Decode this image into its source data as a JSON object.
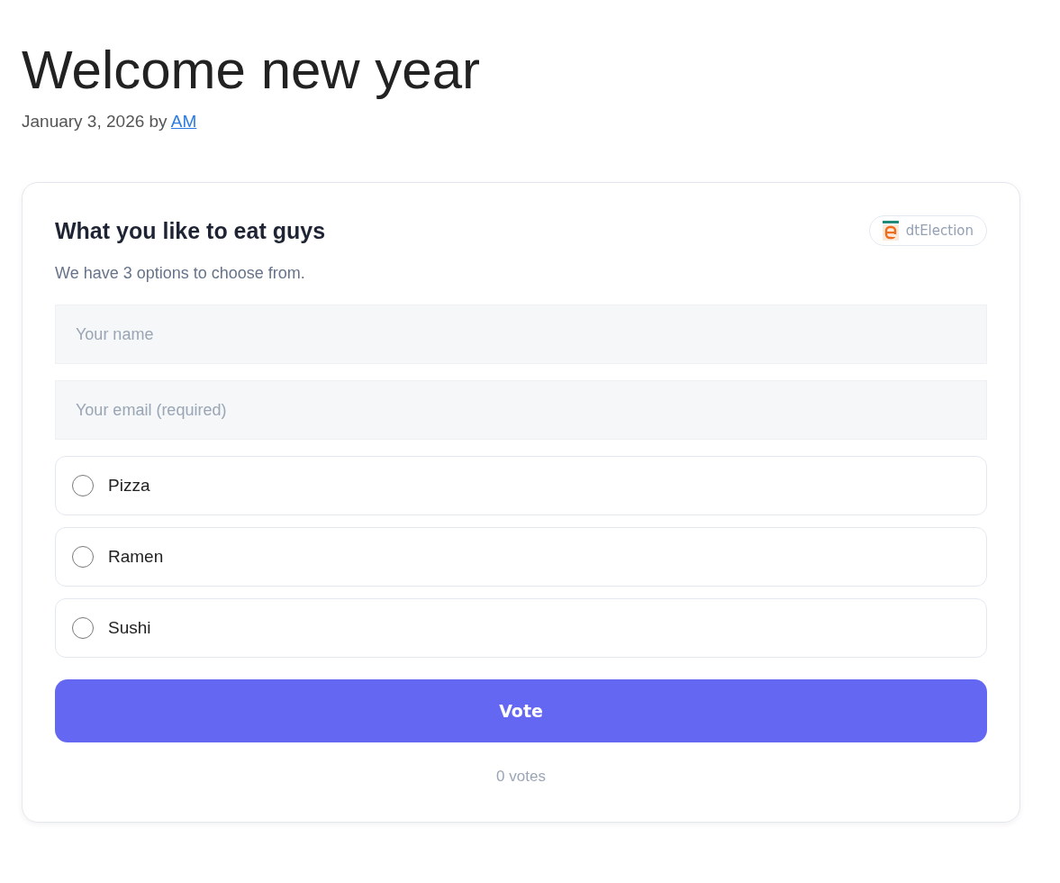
{
  "post": {
    "title": "Welcome new year",
    "byline": "January 3, 2026 by",
    "author": "AM"
  },
  "poll": {
    "question": "What you like to eat guys",
    "badge": "dtElection",
    "description": "We have 3 options to choose from.",
    "fields": [
      {
        "placeholder": "Your name"
      },
      {
        "placeholder": "Your email (required)"
      }
    ],
    "options": [
      {
        "label": "Pizza",
        "selected": false
      },
      {
        "label": "Ramen",
        "selected": false
      },
      {
        "label": "Sushi",
        "selected": false
      }
    ],
    "button": "Vote",
    "votes": "0 votes"
  }
}
